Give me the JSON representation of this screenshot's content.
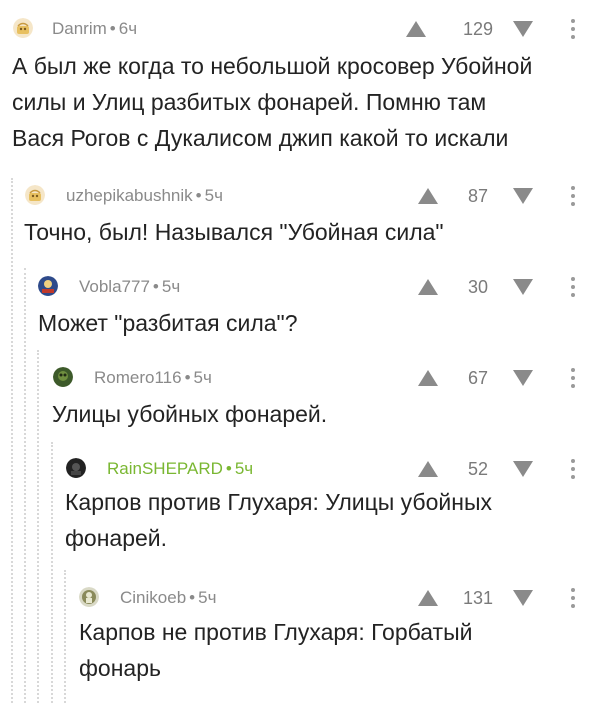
{
  "comments": [
    {
      "username": "Danrim",
      "age": "6ч",
      "rating": "129",
      "lines": [
        "А был же когда то небольшой кросовер Убойной",
        "силы и Улиц разбитых фонарей. Помню там",
        "Вася  Рогов с Дукалисом джип какой то искали"
      ]
    },
    {
      "username": "uzhepikabushnik",
      "age": "5ч",
      "rating": "87",
      "lines": [
        "Точно, был! Назывался \"Убойная сила\""
      ]
    },
    {
      "username": "Vobla777",
      "age": "5ч",
      "rating": "30",
      "lines": [
        "Может \"разбитая сила\"?"
      ]
    },
    {
      "username": "Romero116",
      "age": "5ч",
      "rating": "67",
      "lines": [
        "Улицы убойных фонарей."
      ]
    },
    {
      "username": "RainSHEPARD",
      "age": "5ч",
      "rating": "52",
      "lines": [
        "Карпов против Глухаря: Улицы убойных",
        "фонарей."
      ]
    },
    {
      "username": "Cinikoeb",
      "age": "5ч",
      "rating": "131",
      "lines": [
        "Карпов не против Глухаря: Горбатый",
        "фонарь"
      ]
    }
  ],
  "separator": "•",
  "colors": {
    "meta": "#8a8a8a",
    "highlight_username": "#7ab732",
    "thread_line": "#d8d8d8",
    "text": "#232323"
  },
  "icons": {
    "upvote": "triangle-up-icon",
    "downvote": "triangle-down-icon",
    "more": "vertical-dots-icon"
  }
}
